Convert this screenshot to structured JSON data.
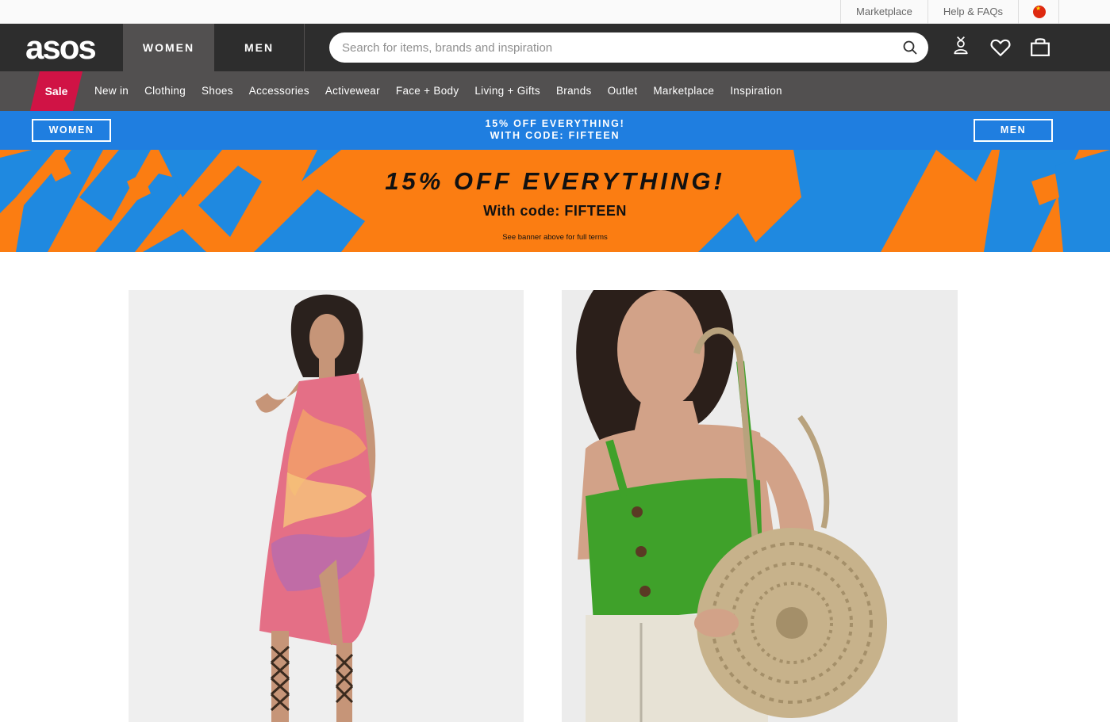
{
  "util_bar": {
    "links": [
      "Marketplace",
      "Help & FAQs"
    ],
    "flag_icon": "china-flag-icon"
  },
  "header": {
    "logo": "asos",
    "tabs": {
      "women": "WOMEN",
      "men": "MEN"
    },
    "search": {
      "placeholder": "Search for items, brands and inspiration",
      "value": ""
    },
    "icons": [
      "account-icon",
      "heart-icon",
      "bag-icon",
      "search-icon"
    ]
  },
  "nav": {
    "sale": "Sale",
    "items": [
      "New in",
      "Clothing",
      "Shoes",
      "Accessories",
      "Activewear",
      "Face + Body",
      "Living + Gifts",
      "Brands",
      "Outlet",
      "Marketplace",
      "Inspiration"
    ]
  },
  "promo_strip": {
    "women_button": "WOMEN",
    "men_button": "MEN",
    "line1": "15% OFF EVERYTHING!",
    "line2": "WITH CODE: FIFTEEN"
  },
  "banner": {
    "title": "15% OFF EVERYTHING!",
    "code": "With code: FIFTEEN",
    "terms": "See banner above for full terms"
  },
  "colors": {
    "header_bg": "#2d2d2d",
    "nav_bg": "#525050",
    "sale": "#d01345",
    "promo_blue": "#1f7ee0",
    "banner_orange": "#fb7d12"
  }
}
